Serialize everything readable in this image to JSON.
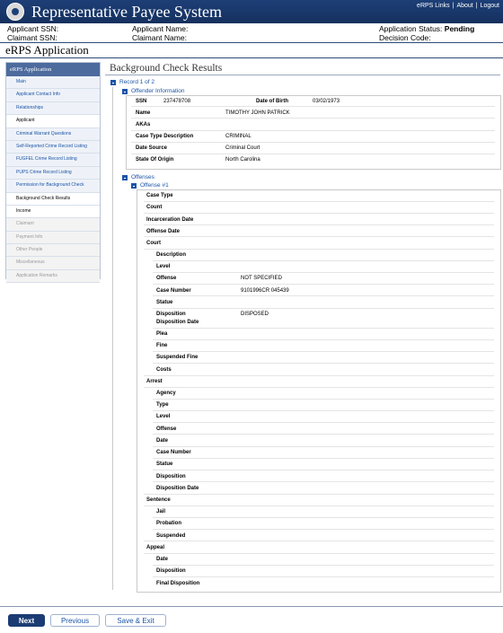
{
  "app": {
    "title": "Representative Payee System",
    "top_links": [
      "eRPS Links",
      "About",
      "Logout"
    ]
  },
  "header": {
    "applicant_ssn_label": "Applicant SSN:",
    "claimant_ssn_label": "Claimant SSN:",
    "applicant_name_label": "Applicant Name:",
    "claimant_name_label": "Claimant Name:",
    "application_status_label": "Application Status:",
    "application_status_value": "Pending",
    "decision_code_label": "Decision Code:"
  },
  "app_section_title": "eRPS Application",
  "sidebar": {
    "heading": "eRPS Application",
    "items": [
      {
        "label": "Main",
        "state": "link"
      },
      {
        "label": "Applicant Contact Info",
        "state": "link"
      },
      {
        "label": "Relationships",
        "state": "link"
      },
      {
        "label": "Applicant",
        "state": "plain"
      },
      {
        "label": "Criminal Warrant Questions",
        "state": "link"
      },
      {
        "label": "Self-Reported Crime Record Listing",
        "state": "link"
      },
      {
        "label": "FUGFEL Crime Record Listing",
        "state": "link"
      },
      {
        "label": "PUPS Crime Record Listing",
        "state": "link"
      },
      {
        "label": "Permission for Background Check",
        "state": "link"
      },
      {
        "label": "Background Check Results",
        "state": "plain"
      },
      {
        "label": "Income",
        "state": "plain"
      },
      {
        "label": "Claimant",
        "state": "disabled"
      },
      {
        "label": "Payment Info",
        "state": "disabled"
      },
      {
        "label": "Other People",
        "state": "disabled"
      },
      {
        "label": "Miscellaneous",
        "state": "disabled"
      },
      {
        "label": "Application Remarks",
        "state": "disabled"
      }
    ]
  },
  "main": {
    "title": "Background Check Results",
    "record_label": "Record 1 of 2",
    "offender_info_label": "Offender Information",
    "offender": {
      "ssn_label": "SSN",
      "ssn_value": "237478708",
      "dob_label": "Date of Birth",
      "dob_value": "03/02/1973",
      "name_label": "Name",
      "name_value": "TIMOTHY JOHN  PATRICK",
      "akas_label": "AKAs",
      "case_type_label": "Case Type Description",
      "case_type_value": "CRIMINAL",
      "date_source_label": "Date Source",
      "date_source_value": "Criminal Court",
      "state_label": "State Of Origin",
      "state_value": "North Carolina"
    },
    "offenses_label": "Offenses",
    "offense_label": "Offense #1",
    "offense_fields": {
      "case_type": "Case Type",
      "count": "Count",
      "incarceration_date": "Incarceration Date",
      "offense_date": "Offense Date",
      "court": "Court"
    },
    "court": {
      "description": "Description",
      "level": "Level",
      "offense_label": "Offense",
      "offense_value": "NOT SPECIFIED",
      "case_number_label": "Case Number",
      "case_number_value": "9101996CR 045439",
      "statue": "Statue",
      "disposition_label": "Disposition",
      "disposition_value": "DISPOSED",
      "disposition_date": "Disposition Date",
      "plea": "Plea",
      "fine": "Fine",
      "suspended_fine": "Suspended Fine",
      "costs": "Costs"
    },
    "arrest": {
      "heading": "Arrest",
      "agency": "Agency",
      "type": "Type",
      "level": "Level",
      "offense": "Offense",
      "date": "Date",
      "case_number": "Case Number",
      "statue": "Statue",
      "disposition": "Disposition",
      "disposition_date": "Disposition Date"
    },
    "sentence": {
      "heading": "Sentence",
      "jail": "Jail",
      "probation": "Probation",
      "suspended": "Suspended"
    },
    "appeal": {
      "heading": "Appeal",
      "date": "Date",
      "disposition": "Disposition",
      "final_disposition": "Final Disposition"
    }
  },
  "buttons": {
    "next": "Next",
    "previous": "Previous",
    "save_exit": "Save & Exit"
  }
}
